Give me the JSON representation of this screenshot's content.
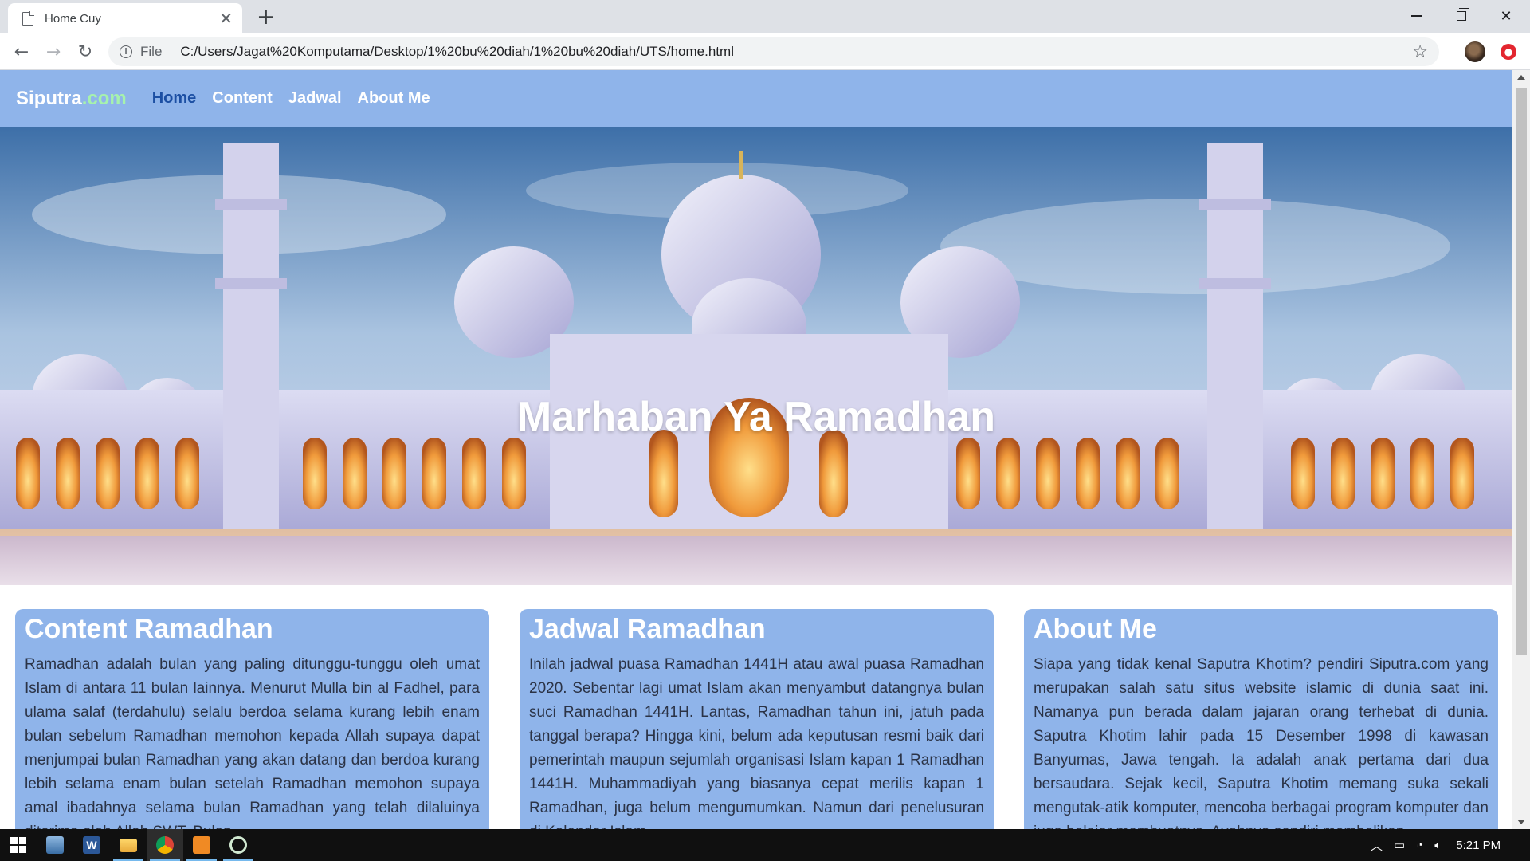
{
  "browser": {
    "tab_title": "Home Cuy",
    "tab_close": "✕",
    "new_tab": "+",
    "omnibox_scheme": "File",
    "url": "C:/Users/Jagat%20Komputama/Desktop/1%20bu%20diah/1%20bu%20diah/UTS/home.html"
  },
  "site": {
    "brand_part1": "Si",
    "brand_part2": "putra",
    "brand_part3": ".com",
    "nav": [
      "Home",
      "Content",
      "Jadwal",
      "About Me"
    ],
    "active_nav": "Home",
    "hero_title": "Marhaban Ya Ramadhan",
    "cards": [
      {
        "title": "Content Ramadhan",
        "text": "Ramadhan adalah bulan yang paling ditunggu-tunggu oleh umat Islam di antara 11 bulan lainnya. Menurut Mulla bin al Fadhel, para ulama salaf (terdahulu) selalu berdoa selama kurang lebih enam bulan sebelum Ramadhan memohon kepada Allah supaya dapat menjumpai bulan Ramadhan yang akan datang dan berdoa kurang lebih selama enam bulan setelah Ramadhan memohon supaya amal ibadahnya selama bulan Ramadhan yang telah dilaluinya diterima oleh Allah SWT. Bulan"
      },
      {
        "title": "Jadwal Ramadhan",
        "text": "Inilah jadwal puasa Ramadhan 1441H atau awal puasa Ramadhan 2020. Sebentar lagi umat Islam akan menyambut datangnya bulan suci Ramadhan 1441H. Lantas, Ramadhan tahun ini, jatuh pada tanggal berapa? Hingga kini, belum ada keputusan resmi baik dari pemerintah maupun sejumlah organisasi Islam kapan 1 Ramadhan 1441H. Muhammadiyah yang biasanya cepat merilis kapan 1 Ramadhan, juga belum mengumumkan. Namun dari penelusuran di Kalender Islam"
      },
      {
        "title": "About Me",
        "text": "Siapa yang tidak kenal Saputra Khotim? pendiri Siputra.com yang merupakan salah satu situs website islamic di dunia saat ini. Namanya pun berada dalam jajaran orang terhebat di dunia. Saputra Khotim lahir pada 15 Desember 1998 di kawasan Banyumas, Jawa tengah. Ia adalah anak pertama dari dua bersaudara. Sejak kecil, Saputra Khotim memang suka sekali mengutak-atik komputer, mencoba berbagai program komputer dan juga belajar membuatnya. Ayahnya sendiri membelikan"
      }
    ]
  },
  "taskbar": {
    "clock": "5:21 PM",
    "pinned_icons": [
      "windows-start-icon",
      "file-manager-icon",
      "word-icon",
      "file-explorer-icon",
      "chrome-icon",
      "sublime-text-icon",
      "tool-icon"
    ],
    "active": [
      "file-explorer-icon",
      "chrome-icon",
      "sublime-text-icon",
      "tool-icon"
    ]
  },
  "colors": {
    "nav_bg": "#8fb4ea",
    "brand_green": "#a6f2ad",
    "active_link": "#1c4fa3",
    "card_bg": "#8fb4ea"
  }
}
